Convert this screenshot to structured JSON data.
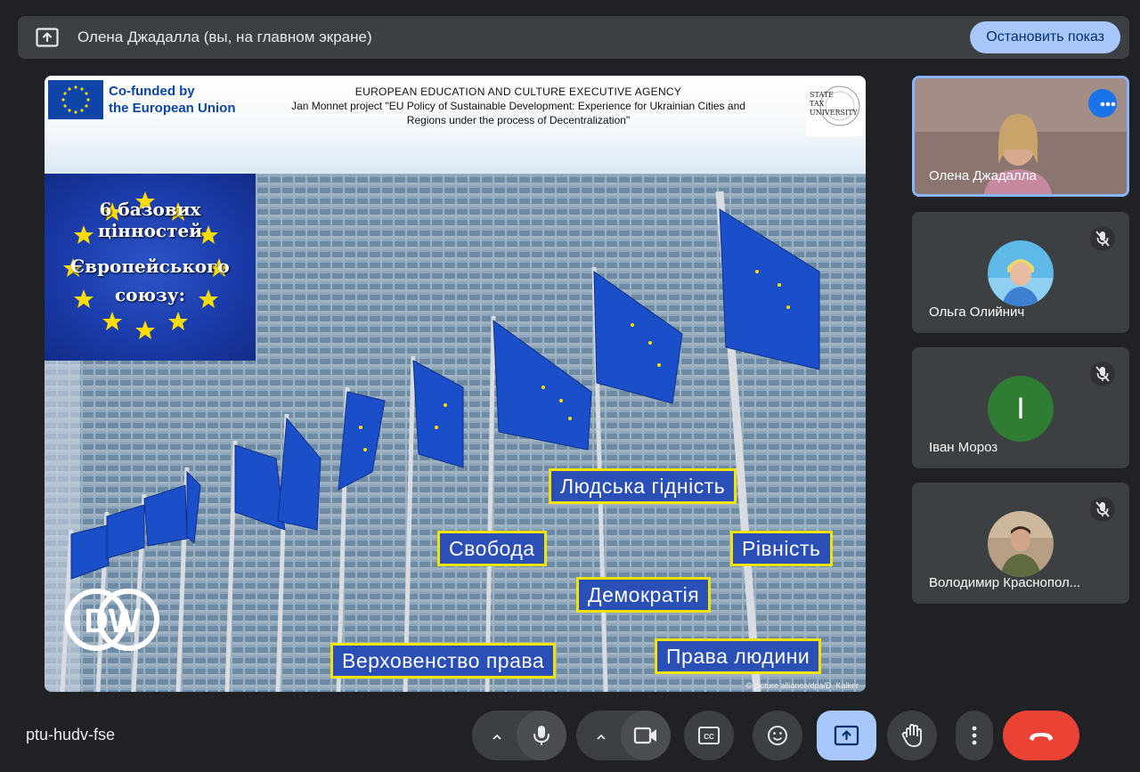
{
  "banner": {
    "present_icon": "present-to-all-icon",
    "text": "Олена Джадалла (вы, на главном экране)",
    "stop_button": "Остановить показ"
  },
  "slide": {
    "eu_logo_text_line1": "Co-funded by",
    "eu_logo_text_line2": "the European Union",
    "agency_line1": "EUROPEAN EDUCATION AND CULTURE EXECUTIVE AGENCY",
    "agency_line2": "Jan Monnet project \"EU Policy of Sustainable Development: Experience for Ukrainian Cities and",
    "agency_line3": "Regions under the process of Decentralization\"",
    "university_logo_lines": [
      "STATE",
      "TAX",
      "UNIVERSITY"
    ],
    "values_title": [
      "6 базових цінностей",
      "Європейського",
      "союзу:"
    ],
    "values": {
      "dignity": "Людська гідність",
      "freedom": "Свобода",
      "equality": "Рівність",
      "democracy": "Демократія",
      "rule_of_law": "Верховенство права",
      "human_rights": "Права людини"
    },
    "dw_logo": "DW",
    "photo_credit": "© picture alliance/dpa/D. Kalker"
  },
  "participants": [
    {
      "name": "Олена Джадалла",
      "active": true,
      "more_icon": "more-horiz-icon"
    },
    {
      "name": "Ольга Олийнич",
      "muted": true
    },
    {
      "name": "Іван Мороз",
      "muted": true,
      "initial": "I",
      "avatar_color": "#2f7d32"
    },
    {
      "name": "Володимир Краснопол...",
      "muted": true
    }
  ],
  "meeting_code": "ptu-hudv-fse",
  "controls": {
    "mic_icon": "mic-icon",
    "camera_icon": "videocam-icon",
    "captions_icon": "closed-caption-icon",
    "emoji_icon": "emoji-icon",
    "present_icon": "present-to-all-icon",
    "hand_icon": "raise-hand-icon",
    "more_icon": "more-vert-icon",
    "hangup_icon": "call-end-icon"
  },
  "colors": {
    "background": "#202124",
    "surface": "#3c4043",
    "accent": "#a8c7fa",
    "hangup": "#ea4335",
    "value_border": "#f3e300",
    "value_fill": "#2a4fb7"
  }
}
